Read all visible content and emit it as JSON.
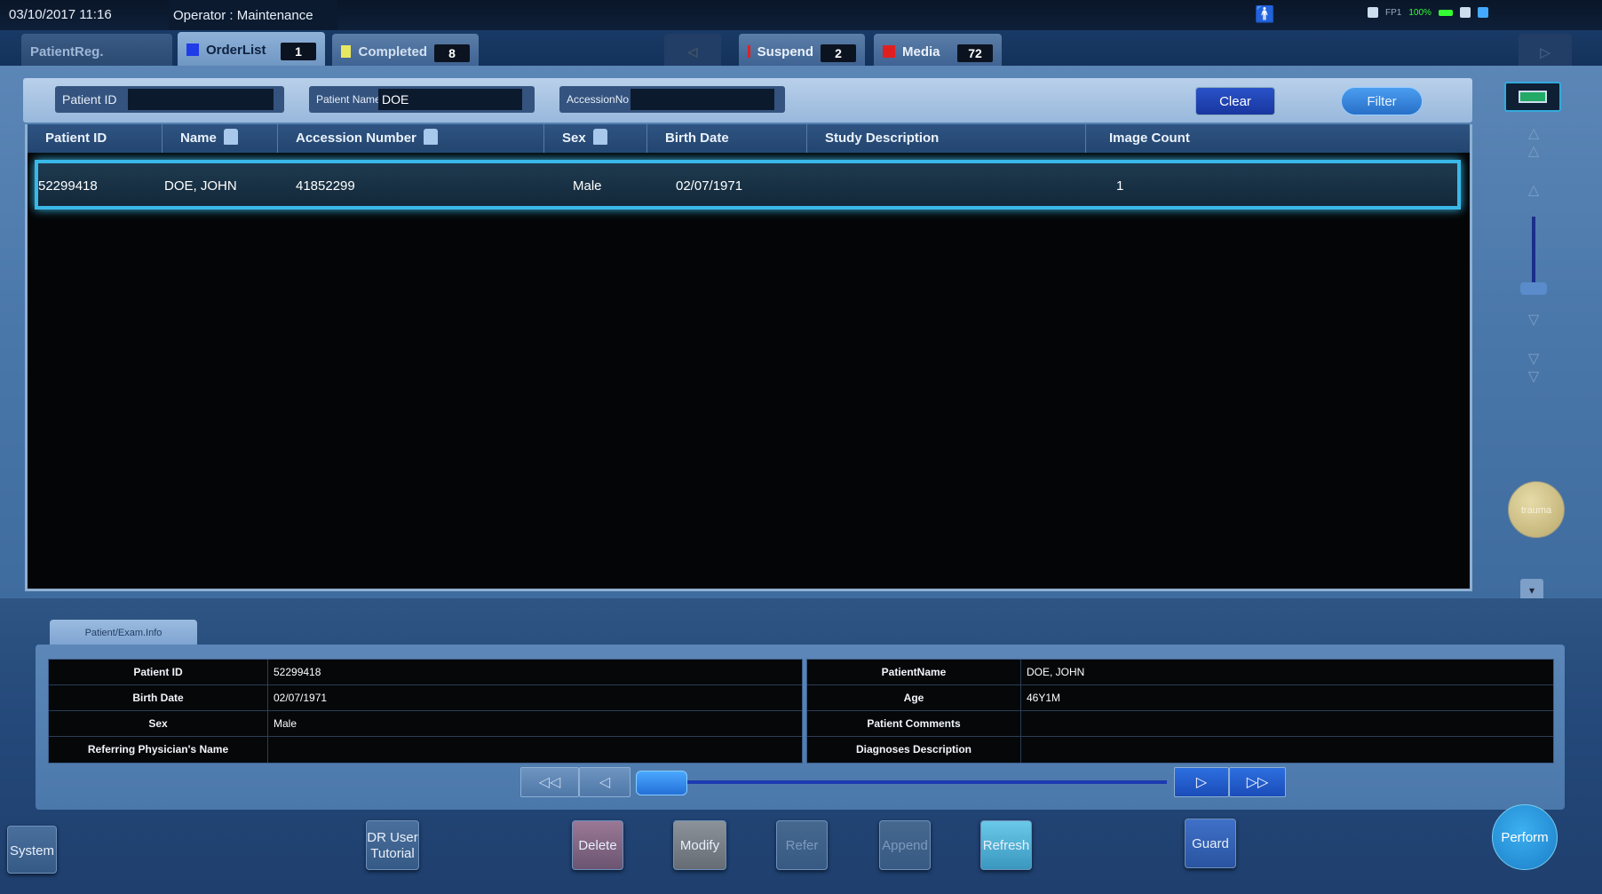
{
  "topbar": {
    "datetime": "03/10/2017 11:16",
    "operator": "Operator : Maintenance",
    "person_icon": "person-icon",
    "status_text": "FP1",
    "battery_text": "100%"
  },
  "tabs": {
    "patientreg": {
      "label": "PatientReg."
    },
    "orderlist": {
      "label": "OrderList",
      "count": "1",
      "color": "#1f3ce8"
    },
    "completed": {
      "label": "Completed",
      "count": "8",
      "color": "#e8e860"
    },
    "center_arrow": "◁",
    "suspend": {
      "label": "Suspend",
      "count": "2",
      "color": "#e02020"
    },
    "media": {
      "label": "Media",
      "count": "72",
      "color": "#e02020"
    },
    "right_arrow": "▷"
  },
  "search": {
    "patient_id_label": "Patient ID",
    "patient_id_value": "",
    "patient_name_label": "Patient Name",
    "patient_name_value": "DOE",
    "accession_label": "AccessionNo",
    "accession_value": "",
    "clear_label": "Clear",
    "filter_label": "Filter"
  },
  "grid": {
    "columns": [
      "Patient ID",
      "Name",
      "Accession Number",
      "Sex",
      "Birth Date",
      "Study Description",
      "Image Count"
    ],
    "rows": [
      {
        "patient_id": "52299418",
        "name": "DOE, JOHN",
        "accession": "41852299",
        "sex": "Male",
        "birth_date": "02/07/1971",
        "study_description": "",
        "image_count": "1"
      }
    ]
  },
  "side": {
    "trauma_label": "trauma",
    "collapse_glyph": "▾"
  },
  "info": {
    "tab_label": "Patient/Exam.Info",
    "left": [
      {
        "k": "Patient ID",
        "v": "52299418"
      },
      {
        "k": "Birth Date",
        "v": "02/07/1971"
      },
      {
        "k": "Sex",
        "v": "Male"
      },
      {
        "k": "Referring Physician's Name",
        "v": ""
      }
    ],
    "right": [
      {
        "k": "PatientName",
        "v": "DOE, JOHN"
      },
      {
        "k": "Age",
        "v": "46Y1M"
      },
      {
        "k": "Patient Comments",
        "v": ""
      },
      {
        "k": "Diagnoses Description",
        "v": ""
      }
    ]
  },
  "pager": {
    "first": "◁◁",
    "prev": "◁",
    "next": "▷",
    "last": "▷▷"
  },
  "actions": {
    "system": "System",
    "tutorial_line1": "DR User",
    "tutorial_line2": "Tutorial",
    "delete": "Delete",
    "modify": "Modify",
    "refer": "Refer",
    "append": "Append",
    "refresh": "Refresh",
    "guard": "Guard",
    "perform": "Perform"
  }
}
